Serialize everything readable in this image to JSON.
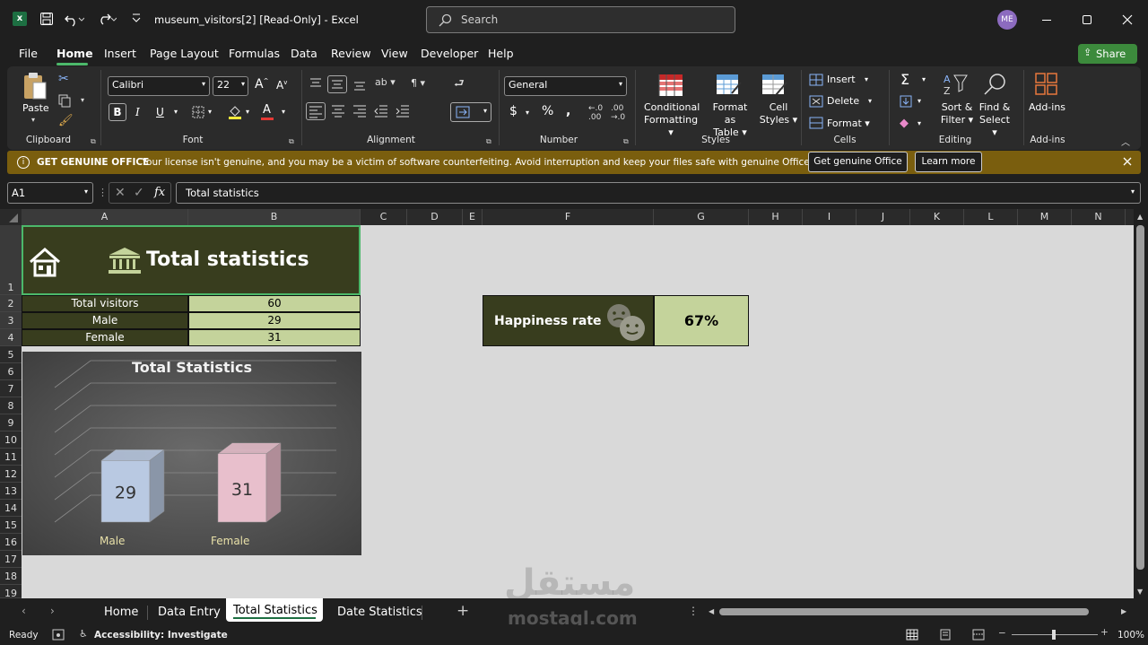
{
  "window": {
    "filename": "museum_visitors[2]",
    "readonly": "[Read-Only]",
    "separator": "-",
    "app": "Excel",
    "search_placeholder": "Search",
    "avatar": "ME"
  },
  "menu": [
    "File",
    "Home",
    "Insert",
    "Page Layout",
    "Formulas",
    "Data",
    "Review",
    "View",
    "Developer",
    "Help"
  ],
  "share_label": "Share",
  "ribbon": {
    "clipboard": {
      "paste": "Paste",
      "group": "Clipboard"
    },
    "font": {
      "name": "Calibri",
      "size": "22",
      "group": "Font"
    },
    "alignment": {
      "group": "Alignment"
    },
    "number": {
      "format": "General",
      "group": "Number",
      "currency": "$",
      "percent": "%"
    },
    "styles": {
      "conditional1": "Conditional",
      "conditional2": "Formatting",
      "formatas1": "Format as",
      "formatas2": "Table",
      "cell1": "Cell",
      "cell2": "Styles",
      "group": "Styles"
    },
    "cells": {
      "insert": "Insert",
      "delete": "Delete",
      "format": "Format",
      "group": "Cells"
    },
    "editing": {
      "sort1": "Sort &",
      "sort2": "Filter",
      "find1": "Find &",
      "find2": "Select",
      "group": "Editing"
    },
    "addins": {
      "label": "Add-ins",
      "group": "Add-ins"
    }
  },
  "warning": {
    "title": "GET GENUINE OFFICE",
    "message": "Your license isn't genuine, and you may be a victim of software counterfeiting. Avoid interruption and keep your files safe with genuine Office today.",
    "button1": "Get genuine Office",
    "button2": "Learn more"
  },
  "formula_bar": {
    "name_box": "A1",
    "formula": "Total statistics",
    "fx": "fx"
  },
  "columns": [
    "A",
    "B",
    "C",
    "D",
    "E",
    "F",
    "G",
    "H",
    "I",
    "J",
    "K",
    "L",
    "M",
    "N"
  ],
  "rows": [
    "1",
    "2",
    "3",
    "4",
    "5",
    "6",
    "7",
    "8",
    "9",
    "10",
    "11",
    "12",
    "13",
    "14",
    "15",
    "16",
    "17",
    "18",
    "19"
  ],
  "sheet": {
    "title": "Total statistics",
    "table": [
      {
        "label": "Total visitors",
        "value": "60"
      },
      {
        "label": "Male",
        "value": "29"
      },
      {
        "label": "Female",
        "value": "31"
      }
    ],
    "happiness_label": "Happiness rate",
    "happiness_value": "67%"
  },
  "chart_data": {
    "type": "bar",
    "title": "Total Statistics",
    "categories": [
      "Male",
      "Female"
    ],
    "values": [
      29,
      31
    ],
    "colors": [
      "#b9c9e2",
      "#e8bfcc"
    ],
    "ylim": [
      0,
      40
    ],
    "grid": true
  },
  "tabs": [
    "Home",
    "Data Entry",
    "Total Statistics",
    "Date Statistics"
  ],
  "active_tab": "Total Statistics",
  "status": {
    "ready": "Ready",
    "accessibility": "Accessibility: Investigate",
    "zoom": "100%"
  },
  "watermark": {
    "arabic": "مستقل",
    "latin": "mostaql.com"
  },
  "colors": {
    "dark_cell": "#383d1e",
    "light_cell": "#c4d39b",
    "warning": "#7a5e0e",
    "share": "#3c8a3c"
  }
}
